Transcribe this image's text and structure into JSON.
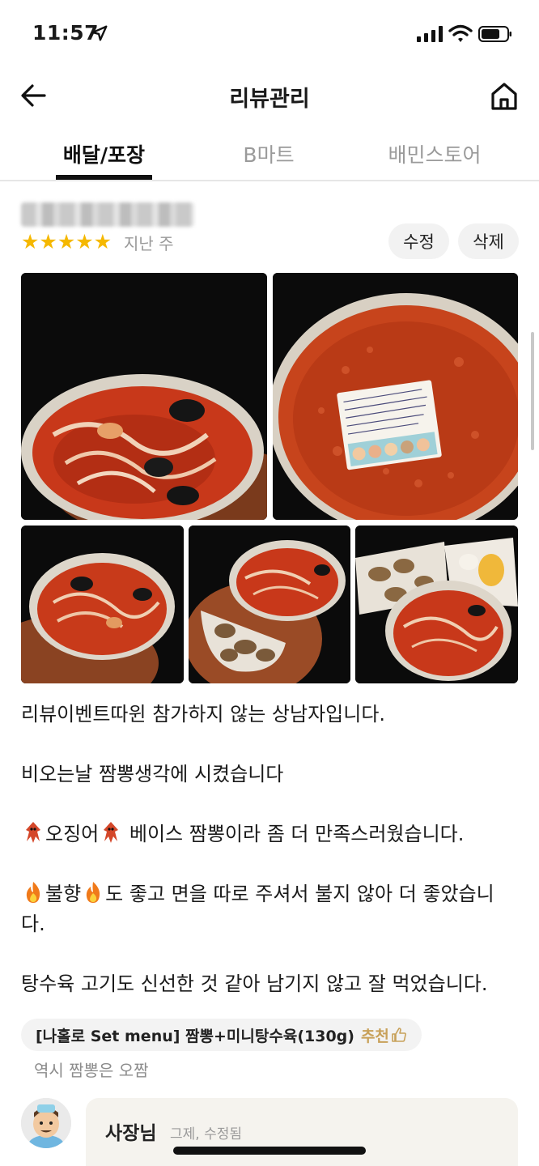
{
  "status_bar": {
    "time": "11:57"
  },
  "nav": {
    "title": "리뷰관리"
  },
  "tabs": [
    {
      "label": "배달/포장",
      "active": true
    },
    {
      "label": "B마트",
      "active": false
    },
    {
      "label": "배민스토어",
      "active": false
    }
  ],
  "review": {
    "stars": "★★★★★",
    "rating": 5,
    "date": "지난 주",
    "edit_label": "수정",
    "delete_label": "삭제",
    "body": [
      "리뷰이벤트따윈 참가하지 않는 상남자입니다.",
      "",
      "비오는날 짬뽕생각에 시켰습니다",
      "",
      "오징어 베이스 짬뽕이라 좀 더 만족스러웠습니다.",
      "",
      "불향 도 좋고 면을 따로 주셔서 불지 않아 더 좋았습니",
      "다.",
      "",
      "탕수육 고기도 신선한 것 같아 남기지 않고 잘 먹었습니다."
    ],
    "line_parts": {
      "squid_word": "오징어",
      "squid_rest": " 베이스 짬뽕이라 좀 더 만족스러웠습니다.",
      "fire_word": "불향",
      "fire_rest": "도 좋고 면을 따로 주셔서 불지 않아 더 좋았습니"
    },
    "menu_item": "[나홀로 Set menu] 짬뽕+미니탕수육(130g)",
    "recommend_label": "추천",
    "menu_note": "역시 짬뽕은 오짬"
  },
  "owner_reply": {
    "name": "사장님",
    "meta": "그제, 수정됨"
  },
  "colors": {
    "star": "#f5b800",
    "recommend": "#c8a15a",
    "soup": "#c83a1a"
  },
  "icons": [
    "location-arrow-icon",
    "signal-icon",
    "wifi-icon",
    "battery-icon",
    "back-arrow-icon",
    "home-icon",
    "thumbs-up-icon",
    "squid-icon",
    "fire-icon"
  ]
}
